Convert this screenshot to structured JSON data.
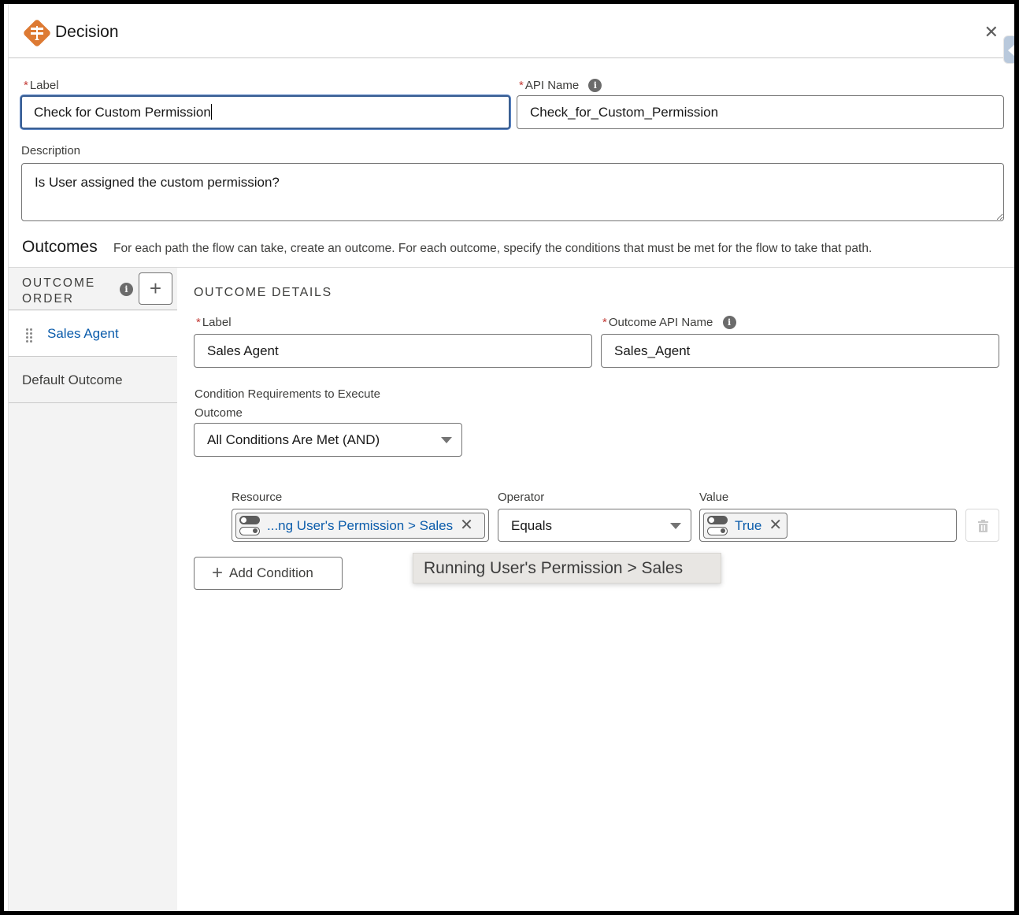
{
  "header": {
    "title": "Decision",
    "icon": "decision-signpost-icon",
    "close_icon": "close-icon",
    "brand_color": "#DD7A33"
  },
  "form": {
    "label": {
      "label": "Label",
      "value": "Check for Custom Permission",
      "required": true
    },
    "api_name": {
      "label": "API Name",
      "value": "Check_for_Custom_Permission",
      "required": true,
      "info_icon": "info-icon"
    },
    "description": {
      "label": "Description",
      "value": "Is User assigned the custom permission?"
    }
  },
  "outcomes": {
    "title": "Outcomes",
    "help_text": "For each path the flow can take, create an outcome. For each outcome, specify the conditions that must be met for the flow to take that path."
  },
  "sidebar": {
    "heading_line1": "OUTCOME",
    "heading_line2": "ORDER",
    "add_button": "+",
    "items": [
      {
        "label": "Sales Agent",
        "active": true
      },
      {
        "label": "Default Outcome",
        "active": false
      }
    ]
  },
  "outcome_details": {
    "section_title": "OUTCOME DETAILS",
    "label": {
      "label": "Label",
      "value": "Sales Agent"
    },
    "api_name": {
      "label": "Outcome API Name",
      "value": "Sales_Agent"
    },
    "condition_requirements": {
      "label_line1": "Condition Requirements to Execute",
      "label_line2": "Outcome",
      "selected": "All Conditions Are Met (AND)"
    },
    "condition": {
      "resource_label": "Resource",
      "resource_value": "...ng User's Permission > Sales",
      "operator_label": "Operator",
      "operator_value": "Equals",
      "value_label": "Value",
      "value_value": "True"
    },
    "add_condition": "Add Condition",
    "tooltip": "Running User's Permission > Sales"
  },
  "colors": {
    "link_blue": "#0B5CAB",
    "required_red": "#C23934",
    "focus_border": "#3A5F93"
  }
}
